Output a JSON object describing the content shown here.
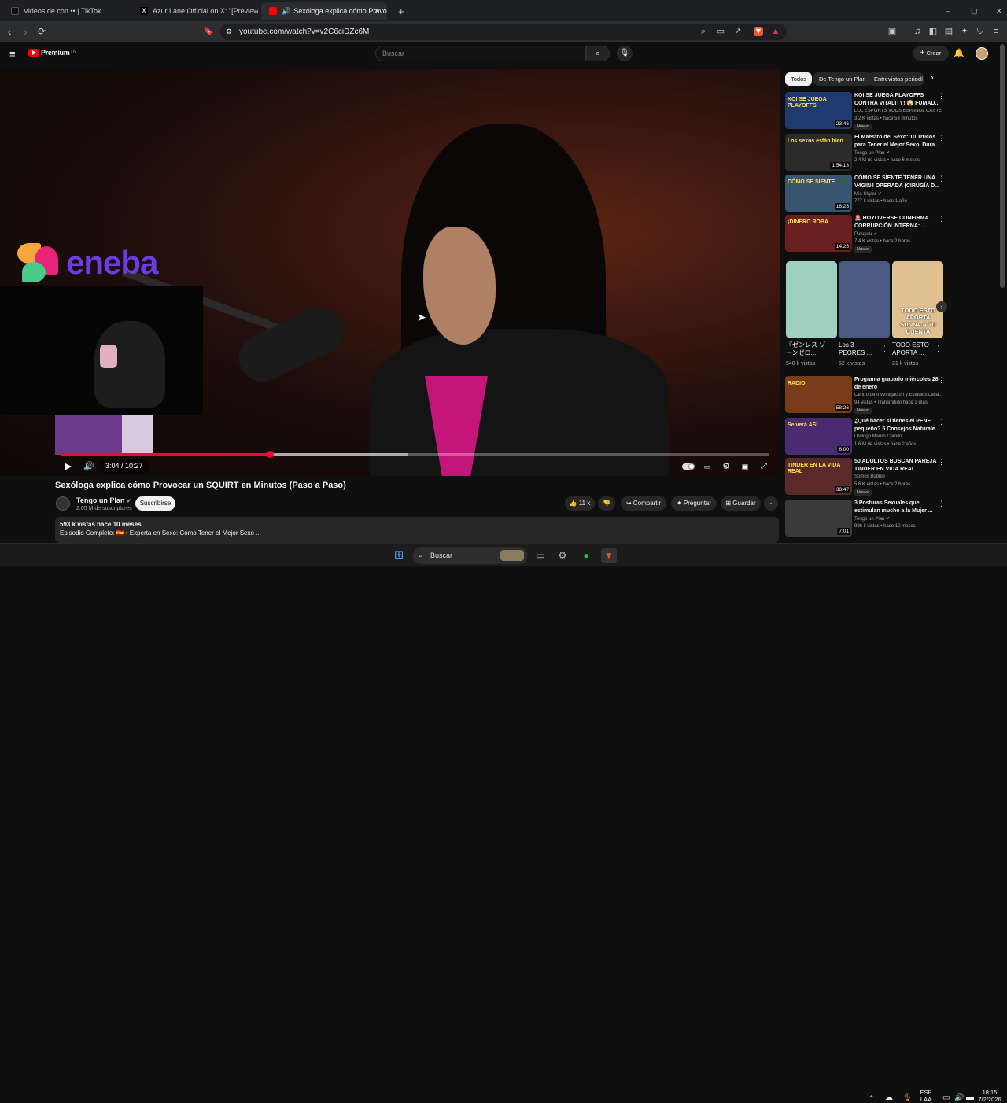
{
  "browser": {
    "tabs": [
      {
        "title": "Videos de con •• | TikTok",
        "active": false
      },
      {
        "title": "Azur Lane Official on X: \"[Preview: Fr",
        "active": false
      },
      {
        "title": "Sexóloga explica cómo Provoc",
        "active": true
      }
    ],
    "new_tab": "+",
    "url": "youtube.com/watch?v=v2C6ciDZc6M",
    "window_controls": {
      "minimize": "–",
      "maximize": "▢",
      "close": "✕"
    }
  },
  "youtube": {
    "logo_text": "Premium",
    "logo_sup": "UY",
    "search_placeholder": "Buscar",
    "create_label": "Crear",
    "video": {
      "overlay_logo_text": "eneba",
      "time": "3:04 / 10:27",
      "progress_fraction": 0.294,
      "buffer_fraction": 0.49,
      "title": "Sexóloga explica cómo Provocar un SQUIRT en Minutos (Paso a Paso)",
      "channel": "Tengo un Plan",
      "subscribers": "2.05 M de suscriptores",
      "subscribe_label": "Suscribirse",
      "likes": "11 k",
      "share_label": "Compartir",
      "ask_label": "Preguntar",
      "save_label": "Guardar",
      "views_line": "593 k vistas  hace 10 meses",
      "description": "Episodio Completo: 🇪🇸 • Experta en Sexo: Cómo Tener el Mejor Sexo ..."
    },
    "chips": [
      "Todos",
      "De Tengo un Plan",
      "Entrevistas periodí"
    ],
    "recommendations": [
      {
        "title": "KOI SE JUEGA PLAYOFFS CONTRA VITALITY! 😱 FUMAD...",
        "channel": "LOL ESPORTS VODS ESPAÑOL CASTEO...",
        "meta": "3.2 K vistas • hace 53 minutos",
        "badge": "Nuevo",
        "duration": "23:46",
        "thumb_text": "KOI SE JUEGA PLAYOFFS",
        "thumb_color": "#1e3a6e"
      },
      {
        "title": "El Maestro del Sexo: 10 Trucos para Tener el Mejor Sexo, Dura...",
        "channel": "Tengo un Plan ✔",
        "meta": "2.4 M de vistas • hace 6 meses",
        "badge": "",
        "duration": "1:54:13",
        "thumb_text": "Los sexos están bien",
        "thumb_color": "#2b2b2b"
      },
      {
        "title": "CÓMO SE SIENTE TENER UNA V4GIN4 OPERADA (CIRUGÍA D...",
        "channel": "Mia Skyler ✔",
        "meta": "777 k vistas • hace 1 año",
        "badge": "",
        "duration": "16:25",
        "thumb_text": "CÓMO SE SIENTE",
        "thumb_color": "#3a5570"
      },
      {
        "title": "🚨 HOYOVERSE CONFIRMA CORRUPCIÓN INTERNA: ...",
        "channel": "Putupau ✔",
        "meta": "7.4 K vistas • hace 2 horas",
        "badge": "Nuevo",
        "duration": "14:25",
        "thumb_text": "¡DINERO ROBA",
        "thumb_color": "#6a1f1f"
      },
      {
        "title": "Programa grabado miércoles 28 de enero",
        "channel": "Centro de Investigación y Estudios Laca...",
        "meta": "94 vistas • Transmitido hace 3 días",
        "badge": "Nuevo",
        "duration": "58:26",
        "thumb_text": "RADIO",
        "thumb_color": "#7a3b1a"
      },
      {
        "title": "¿Qué hacer si tienes el PENE pequeño? 5 Consejos Naturale...",
        "channel": "Urólogo Mauro Carrillo",
        "meta": "1.6 M de vistas • hace 2 años",
        "badge": "",
        "duration": "6:00",
        "thumb_text": "Se verá ASÍ",
        "thumb_color": "#4a2a70"
      },
      {
        "title": "50 ADULTOS BUSCAN PAREJA TINDER EN VIDA REAL",
        "channel": "Somos Bubble",
        "meta": "5.6 K vistas • hace 2 horas",
        "badge": "Nuevo",
        "duration": "38:47",
        "thumb_text": "TINDER EN LA VIDA REAL",
        "thumb_color": "#5a2a2a"
      },
      {
        "title": "3 Posturas Sexuales que estimulan mucho a la Mujer ...",
        "channel": "Tengo un Plan ✔",
        "meta": "996 k vistas • hace 10 meses",
        "badge": "",
        "duration": "7:01",
        "thumb_text": "",
        "thumb_color": "#3a3a3a"
      }
    ],
    "shorts": [
      {
        "title": "『ゼンレス ゾーンゼロ...",
        "views": "548 k vistas",
        "color": "#9fd0c0"
      },
      {
        "title": "Los 3 PEORES ...",
        "views": "62 k vistas",
        "color": "#4a5a80"
      },
      {
        "title": "TODO ESTO APORTA ...",
        "views": "21 k vistas",
        "color": "#e0c090",
        "overlay": "TODO ESTO APORTA SUNNA A TU CUENTA"
      }
    ]
  },
  "taskbar": {
    "search_label": "Buscar",
    "lang": "ESP",
    "lang2": "LAA",
    "time": "18:15",
    "date": "7/2/2026"
  }
}
